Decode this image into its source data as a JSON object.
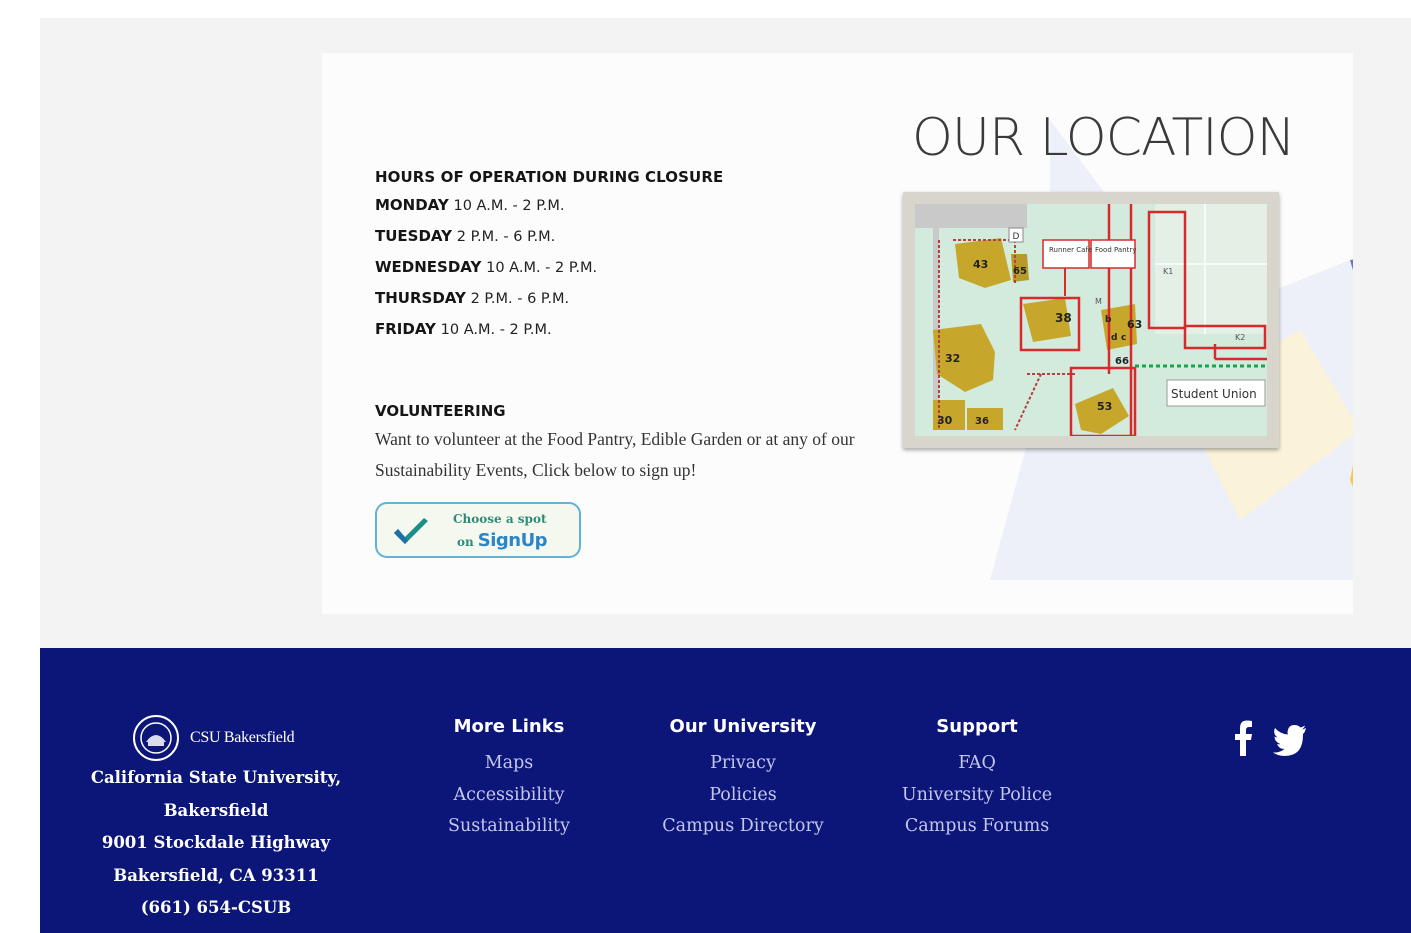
{
  "hours": {
    "title": "HOURS OF OPERATION DURING CLOSURE",
    "days": [
      {
        "day": "MONDAY",
        "time": "10 A.M. - 2 P.M."
      },
      {
        "day": "TUESDAY",
        "time": "2 P.M. - 6 P.M."
      },
      {
        "day": "WEDNESDAY",
        "time": "10 A.M. - 2 P.M."
      },
      {
        "day": "THURSDAY",
        "time": "2 P.M. - 6 P.M."
      },
      {
        "day": "FRIDAY",
        "time": "10 A.M. - 2 P.M."
      }
    ]
  },
  "volunteer": {
    "title": "VOLUNTEERING",
    "text": "Want to volunteer at the Food Pantry, Edible Garden or at any of our Sustainability Events, Click below to sign up!",
    "button": {
      "line1": "Choose a spot",
      "line2_prefix": "on",
      "brand": "SignUp"
    }
  },
  "location": {
    "title": "OUR LOCATION",
    "map_labels": {
      "runner_cafe": "Runner Cafe",
      "food_pantry": "Food Pantry",
      "student_union": "Student Union",
      "buildings": [
        "43",
        "65",
        "38",
        "63",
        "66",
        "32",
        "53",
        "30",
        "36",
        "b",
        "d",
        "c"
      ],
      "lots": [
        "D",
        "K1",
        "K2",
        "M"
      ]
    },
    "mascot_mark": "TM"
  },
  "footer": {
    "brand": "CSU Bakersfield",
    "address_lines": [
      "California State University,",
      "Bakersfield",
      "9001 Stockdale Highway",
      "Bakersfield, CA 93311",
      "(661) 654-CSUB"
    ],
    "columns": [
      {
        "heading": "More Links",
        "links": [
          "Maps",
          "Accessibility",
          "Sustainability"
        ]
      },
      {
        "heading": "Our University",
        "links": [
          "Privacy",
          "Policies",
          "Campus Directory"
        ]
      },
      {
        "heading": "Support",
        "links": [
          "FAQ",
          "University Police",
          "Campus Forums"
        ]
      }
    ],
    "social": [
      "facebook-icon",
      "twitter-icon"
    ]
  },
  "colors": {
    "footer_bg": "#0c1679",
    "link": "#c4c7ea",
    "map_route": "#d82a2a",
    "map_bg": "#cfe8d8"
  }
}
